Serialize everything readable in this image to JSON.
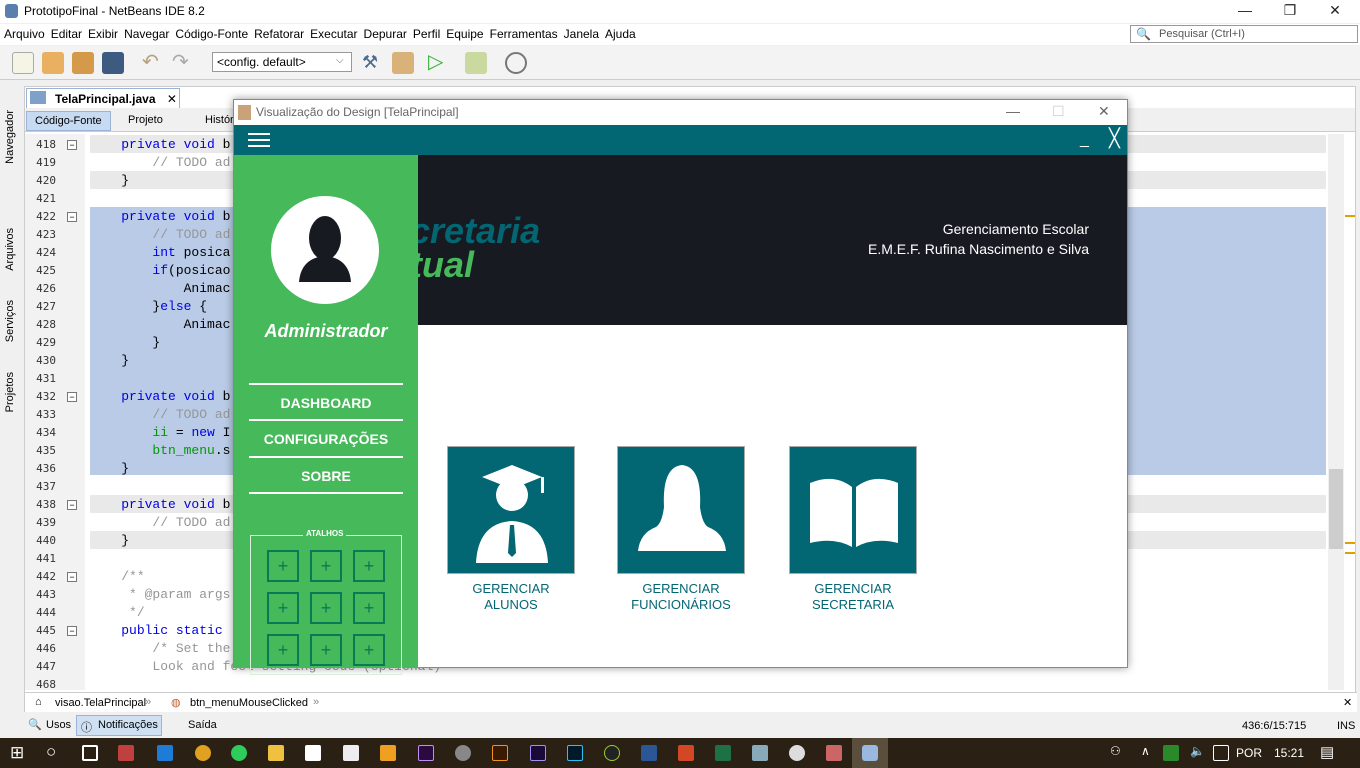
{
  "ide": {
    "title": "PrototipoFinal - NetBeans IDE 8.2",
    "menu": [
      "Arquivo",
      "Editar",
      "Exibir",
      "Navegar",
      "Código-Fonte",
      "Refatorar",
      "Executar",
      "Depurar",
      "Perfil",
      "Equipe",
      "Ferramentas",
      "Janela",
      "Ajuda"
    ],
    "search_placeholder": "Pesquisar (Ctrl+I)",
    "config": "<config. default>",
    "side_tabs": [
      "Navegador",
      "Arquivos",
      "Serviços",
      "Projetos"
    ],
    "file_tab": "TelaPrincipal.java",
    "sub_tabs": [
      "Código-Fonte",
      "Projeto",
      "Histórico"
    ],
    "code": [
      {
        "n": "418",
        "segs": [
          [
            "    "
          ],
          [
            "private void",
            "kw"
          ],
          [
            " b"
          ]
        ]
      },
      {
        "n": "419",
        "segs": [
          [
            "        "
          ],
          [
            "// TODO ad",
            "cm"
          ]
        ]
      },
      {
        "n": "420",
        "segs": [
          [
            "    }"
          ]
        ]
      },
      {
        "n": "421",
        "segs": [
          [
            ""
          ]
        ]
      },
      {
        "n": "422",
        "segs": [
          [
            "    "
          ],
          [
            "private void",
            "kw"
          ],
          [
            " b"
          ]
        ]
      },
      {
        "n": "423",
        "segs": [
          [
            "        "
          ],
          [
            "// TODO ad",
            "cm"
          ]
        ]
      },
      {
        "n": "424",
        "segs": [
          [
            "        "
          ],
          [
            "int",
            "kw"
          ],
          [
            " posica"
          ]
        ]
      },
      {
        "n": "425",
        "segs": [
          [
            "        "
          ],
          [
            "if",
            "kw"
          ],
          [
            "(posicao"
          ]
        ]
      },
      {
        "n": "426",
        "segs": [
          [
            "            Animac"
          ]
        ]
      },
      {
        "n": "427",
        "segs": [
          [
            "        }"
          ],
          [
            "else",
            "kw"
          ],
          [
            " {"
          ]
        ]
      },
      {
        "n": "428",
        "segs": [
          [
            "            Animac"
          ]
        ]
      },
      {
        "n": "429",
        "segs": [
          [
            "        }"
          ]
        ]
      },
      {
        "n": "430",
        "segs": [
          [
            "    }"
          ]
        ]
      },
      {
        "n": "431",
        "segs": [
          [
            ""
          ]
        ]
      },
      {
        "n": "432",
        "segs": [
          [
            "    "
          ],
          [
            "private void",
            "kw"
          ],
          [
            " b"
          ]
        ]
      },
      {
        "n": "433",
        "segs": [
          [
            "        "
          ],
          [
            "// TODO ad",
            "cm"
          ]
        ]
      },
      {
        "n": "434",
        "segs": [
          [
            "        "
          ],
          [
            "ii",
            "fd"
          ],
          [
            " = "
          ],
          [
            "new",
            "kw"
          ],
          [
            " I"
          ]
        ]
      },
      {
        "n": "435",
        "segs": [
          [
            "        "
          ],
          [
            "btn_menu",
            "fd"
          ],
          [
            ".s"
          ]
        ]
      },
      {
        "n": "436",
        "segs": [
          [
            "    }"
          ]
        ]
      },
      {
        "n": "437",
        "segs": [
          [
            ""
          ]
        ]
      },
      {
        "n": "438",
        "segs": [
          [
            "    "
          ],
          [
            "private void",
            "kw"
          ],
          [
            " b"
          ]
        ]
      },
      {
        "n": "439",
        "segs": [
          [
            "        "
          ],
          [
            "// TODO ad",
            "cm"
          ]
        ]
      },
      {
        "n": "440",
        "segs": [
          [
            "    }"
          ]
        ]
      },
      {
        "n": "441",
        "segs": [
          [
            ""
          ]
        ]
      },
      {
        "n": "442",
        "segs": [
          [
            "    "
          ],
          [
            "/**",
            "cm"
          ]
        ]
      },
      {
        "n": "443",
        "segs": [
          [
            "     "
          ],
          [
            "* @param args",
            "cm"
          ]
        ]
      },
      {
        "n": "444",
        "segs": [
          [
            "     "
          ],
          [
            "*/",
            "cm"
          ]
        ]
      },
      {
        "n": "445",
        "segs": [
          [
            "    "
          ],
          [
            "public static",
            "kw"
          ]
        ]
      },
      {
        "n": "446",
        "segs": [
          [
            "        "
          ],
          [
            "/* Set the",
            "cm"
          ]
        ]
      },
      {
        "n": "447",
        "segs": [
          [
            "        "
          ],
          [
            "Look and feel setting code (optional)",
            "cm"
          ]
        ]
      },
      {
        "n": "468",
        "segs": [
          [
            ""
          ]
        ]
      }
    ],
    "breadcrumb": [
      "visao.TelaPrincipal",
      "btn_menuMouseClicked"
    ],
    "bottom_tabs": [
      "Usos",
      "Notificações",
      "Saída"
    ],
    "position": "436:6/15:715",
    "mode": "INS"
  },
  "design": {
    "title": "Visualização do Design [TelaPrincipal]",
    "user": "Administrador",
    "logo_line1": "cretaria",
    "logo_line2": "tual",
    "header_line1": "Gerenciamento Escolar",
    "header_line2": "E.M.E.F. Rufina Nascimento e Silva",
    "menu": [
      "DASHBOARD",
      "CONFIGURAÇÕES",
      "SOBRE"
    ],
    "shortcuts_title": "ATALHOS",
    "shortcut_symbol": "+",
    "tiles": [
      {
        "l1": "GERENCIAR",
        "l2": "ALUNOS",
        "icon": "student-icon"
      },
      {
        "l1": "GERENCIAR",
        "l2": "FUNCIONÁRIOS",
        "icon": "employee-icon"
      },
      {
        "l1": "GERENCIAR",
        "l2": "SECRETARIA",
        "icon": "book-icon"
      }
    ],
    "colors": {
      "teal": "#036673",
      "green": "#46b95a",
      "dark": "#181a22"
    }
  },
  "taskbar": {
    "lang": "POR",
    "time": "15:21"
  }
}
